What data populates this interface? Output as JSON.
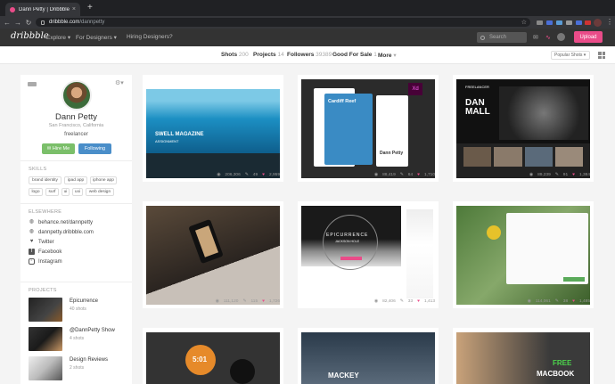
{
  "browser": {
    "tab_title": "Dann Petty | Dribbble",
    "url_host": "dribbble.com",
    "url_path": "/dannpetty"
  },
  "header": {
    "logo": "dribbble",
    "nav": [
      "Explore",
      "For Designers",
      "Hiring Designers?"
    ],
    "search_placeholder": "Search",
    "upload_label": "Upload"
  },
  "subnav": {
    "items": [
      {
        "label": "Shots",
        "count": "200"
      },
      {
        "label": "Projects",
        "count": "14"
      },
      {
        "label": "Followers",
        "count": "39389"
      },
      {
        "label": "Good For Sale",
        "count": "1"
      },
      {
        "label": "More",
        "count": "▾"
      }
    ],
    "sort_label": "Popular Shots ▾"
  },
  "profile": {
    "name": "Dann Petty",
    "location": "San Francisco, California",
    "bio": "freelancer",
    "hire_label": "✉ Hire Me",
    "follow_label": "Following",
    "pro_badge": "PRO",
    "skills_heading": "SKILLS",
    "skills": [
      "brand identity",
      "ipad app",
      "iphone app",
      "logo",
      "surf",
      "ui",
      "uxi",
      "web design"
    ],
    "elsewhere_heading": "ELSEWHERE",
    "links": [
      {
        "icon": "globe-icon",
        "label": "behance.net/dannpetty"
      },
      {
        "icon": "globe-icon",
        "label": "dannpetty.dribbble.com"
      },
      {
        "icon": "twitter-icon",
        "label": "Twitter"
      },
      {
        "icon": "facebook-icon",
        "label": "Facebook"
      },
      {
        "icon": "instagram-icon",
        "label": "Instagram"
      }
    ],
    "projects_heading": "PROJECTS",
    "projects": [
      {
        "name": "Epicurrence",
        "count": "40 shots"
      },
      {
        "name": "@DannPetty Show",
        "count": "4 shots"
      },
      {
        "name": "Design Reviews",
        "count": "2 shots"
      }
    ]
  },
  "shots": [
    {
      "title": "SWELL MAGAZINE",
      "sub": "ASSIGNMENT",
      "views": "206,306",
      "comments": "49",
      "likes": "2,959"
    },
    {
      "title": "Cardiff Reef",
      "sub": "Dann Petty",
      "views": "88,419",
      "comments": "64",
      "likes": "1,710"
    },
    {
      "title": "DAN MALL",
      "sub": "FREELANCER",
      "views": "89,239",
      "comments": "91",
      "likes": "1,384"
    },
    {
      "title": "",
      "sub": "",
      "views": "111,120",
      "comments": "115",
      "likes": "1,726"
    },
    {
      "title": "EPICURRENCE",
      "sub": "JACKSON HOLE",
      "views": "82,406",
      "comments": "33",
      "likes": "1,413"
    },
    {
      "title": "",
      "sub": "",
      "views": "114,061",
      "comments": "38",
      "likes": "1,485"
    },
    {
      "title": "5:01",
      "sub": "",
      "views": "",
      "comments": "",
      "likes": ""
    },
    {
      "title": "MACKEY",
      "sub": "",
      "views": "",
      "comments": "",
      "likes": ""
    },
    {
      "title": "FREE",
      "sub": "MACBOOK",
      "views": "",
      "comments": "",
      "likes": ""
    }
  ],
  "colors": {
    "brand_pink": "#ea4c89",
    "hire_green": "#7bbf6a",
    "follow_blue": "#4a8ec9"
  }
}
